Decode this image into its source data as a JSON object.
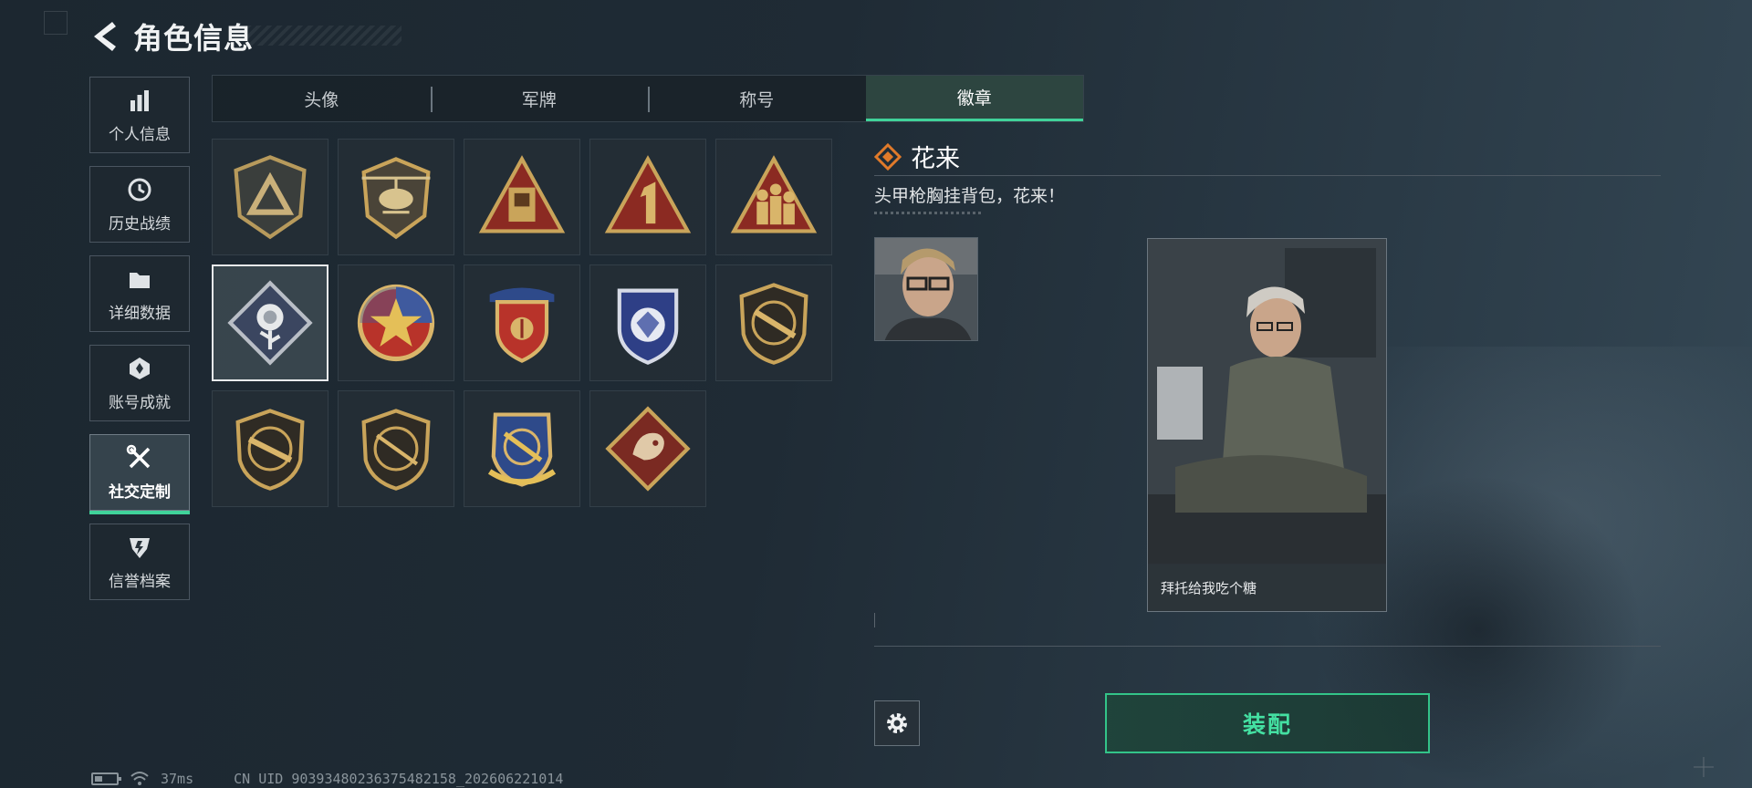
{
  "header": {
    "title": "角色信息"
  },
  "nav": {
    "items": [
      {
        "label": "个人信息",
        "icon": "bar-chart-icon",
        "active": false
      },
      {
        "label": "历史战绩",
        "icon": "history-clock-icon",
        "active": false
      },
      {
        "label": "详细数据",
        "icon": "folder-icon",
        "active": false
      },
      {
        "label": "账号成就",
        "icon": "achievement-icon",
        "active": false
      },
      {
        "label": "社交定制",
        "icon": "tools-icon",
        "active": true
      },
      {
        "label": "信誉档案",
        "icon": "credit-shield-icon",
        "active": false
      }
    ]
  },
  "tabs": [
    {
      "label": "头像",
      "active": false
    },
    {
      "label": "军牌",
      "active": false
    },
    {
      "label": "称号",
      "active": false
    },
    {
      "label": "徽章",
      "active": true
    }
  ],
  "badges": [
    {
      "icon": "triangle-shield-badge-icon",
      "selected": false
    },
    {
      "icon": "helicopter-badge-icon",
      "selected": false
    },
    {
      "icon": "fuel-can-badge-icon",
      "selected": false
    },
    {
      "icon": "number-one-badge-icon",
      "selected": false
    },
    {
      "icon": "soldiers-badge-icon",
      "selected": false
    },
    {
      "icon": "rose-badge-icon",
      "selected": true
    },
    {
      "icon": "star-wheel-badge-icon",
      "selected": false
    },
    {
      "icon": "red-shield-badge-icon",
      "selected": false
    },
    {
      "icon": "blue-gem-badge-icon",
      "selected": false
    },
    {
      "icon": "rifle-badge-icon",
      "selected": false
    },
    {
      "icon": "rifle-badge-icon",
      "selected": false
    },
    {
      "icon": "sniper-badge-icon",
      "selected": false
    },
    {
      "icon": "crossed-rifles-badge-icon",
      "selected": false
    },
    {
      "icon": "dragon-badge-icon",
      "selected": false
    }
  ],
  "detail": {
    "name": "花来",
    "description": "头甲枪胸挂背包，花来！",
    "card_caption": "拜托给我吃个糖"
  },
  "actions": {
    "equip_label": "装配"
  },
  "status": {
    "ping": "37ms",
    "uid": "CN UID 90393480236375482158_202606221014"
  },
  "colors": {
    "accent": "#40d39a",
    "badge_gold": "#c9a45a",
    "badge_red": "#8b2a22"
  }
}
